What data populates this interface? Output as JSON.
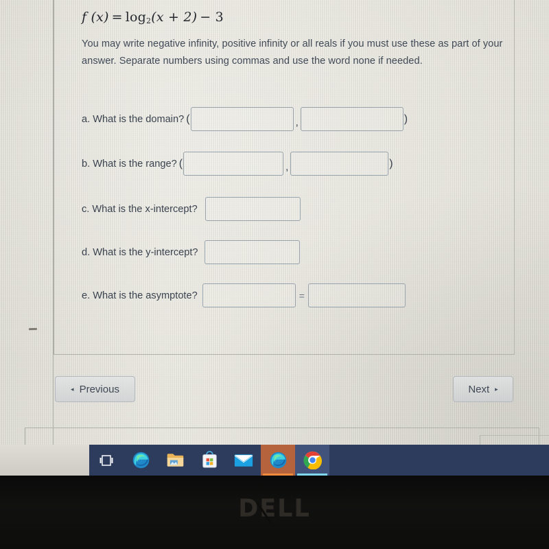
{
  "problem": {
    "formula": {
      "lhs": "f (x)",
      "equals": "=",
      "log": "log",
      "base": "2",
      "argument": "(x + 2)",
      "tail": "− 3",
      "full_text": "f (x) = log₂(x + 2) − 3"
    },
    "instructions": "You may write negative infinity, positive infinity or all reals if you must use these as part of your answer. Separate numbers using commas and use the word none if needed."
  },
  "questions": [
    {
      "id": "a",
      "label": "a. What is the domain?",
      "open_paren": "(",
      "separator": ",",
      "close_paren": ")",
      "inputs": [
        {
          "name": "domain-lower-input",
          "value": "",
          "placeholder": ""
        },
        {
          "name": "domain-upper-input",
          "value": "",
          "placeholder": ""
        }
      ]
    },
    {
      "id": "b",
      "label": "b. What is the range?",
      "open_paren": "(",
      "separator": ",",
      "close_paren": ")",
      "inputs": [
        {
          "name": "range-lower-input",
          "value": "",
          "placeholder": ""
        },
        {
          "name": "range-upper-input",
          "value": "",
          "placeholder": ""
        }
      ]
    },
    {
      "id": "c",
      "label": "c. What is the x-intercept?",
      "inputs": [
        {
          "name": "x-intercept-input",
          "value": "",
          "placeholder": ""
        }
      ]
    },
    {
      "id": "d",
      "label": "d. What is the y-intercept?",
      "inputs": [
        {
          "name": "y-intercept-input",
          "value": "",
          "placeholder": ""
        }
      ]
    },
    {
      "id": "e",
      "label": "e. What is the asymptote?",
      "separator": "=",
      "inputs": [
        {
          "name": "asymptote-variable-input",
          "value": "",
          "placeholder": ""
        },
        {
          "name": "asymptote-value-input",
          "value": "",
          "placeholder": ""
        }
      ]
    }
  ],
  "navigation": {
    "previous_label": "Previous",
    "previous_arrow": "◂",
    "next_label": "Next",
    "next_arrow": "▸"
  },
  "taskbar": {
    "items": [
      {
        "name": "task-view-icon",
        "label": "Task View",
        "state": "idle"
      },
      {
        "name": "microsoft-edge-icon",
        "label": "Microsoft Edge",
        "state": "idle"
      },
      {
        "name": "file-explorer-icon",
        "label": "File Explorer",
        "state": "idle"
      },
      {
        "name": "microsoft-store-icon",
        "label": "Microsoft Store",
        "state": "idle"
      },
      {
        "name": "mail-icon",
        "label": "Mail",
        "state": "idle"
      },
      {
        "name": "microsoft-edge-running-icon",
        "label": "Microsoft Edge",
        "state": "active-orange"
      },
      {
        "name": "google-chrome-icon",
        "label": "Google Chrome",
        "state": "active-blue"
      }
    ],
    "background_color": "#2d3c5c"
  },
  "device": {
    "brand_text": "DELL",
    "brand_letters": [
      "D",
      "E",
      "L",
      "L"
    ]
  },
  "colors": {
    "page_background": "#e9e7df",
    "text": "#3a434f",
    "input_border": "#97a2ab",
    "taskbar": "#2d3c5c",
    "bezel": "#0d0d0c",
    "edge_highlight": "#f08a3c"
  }
}
